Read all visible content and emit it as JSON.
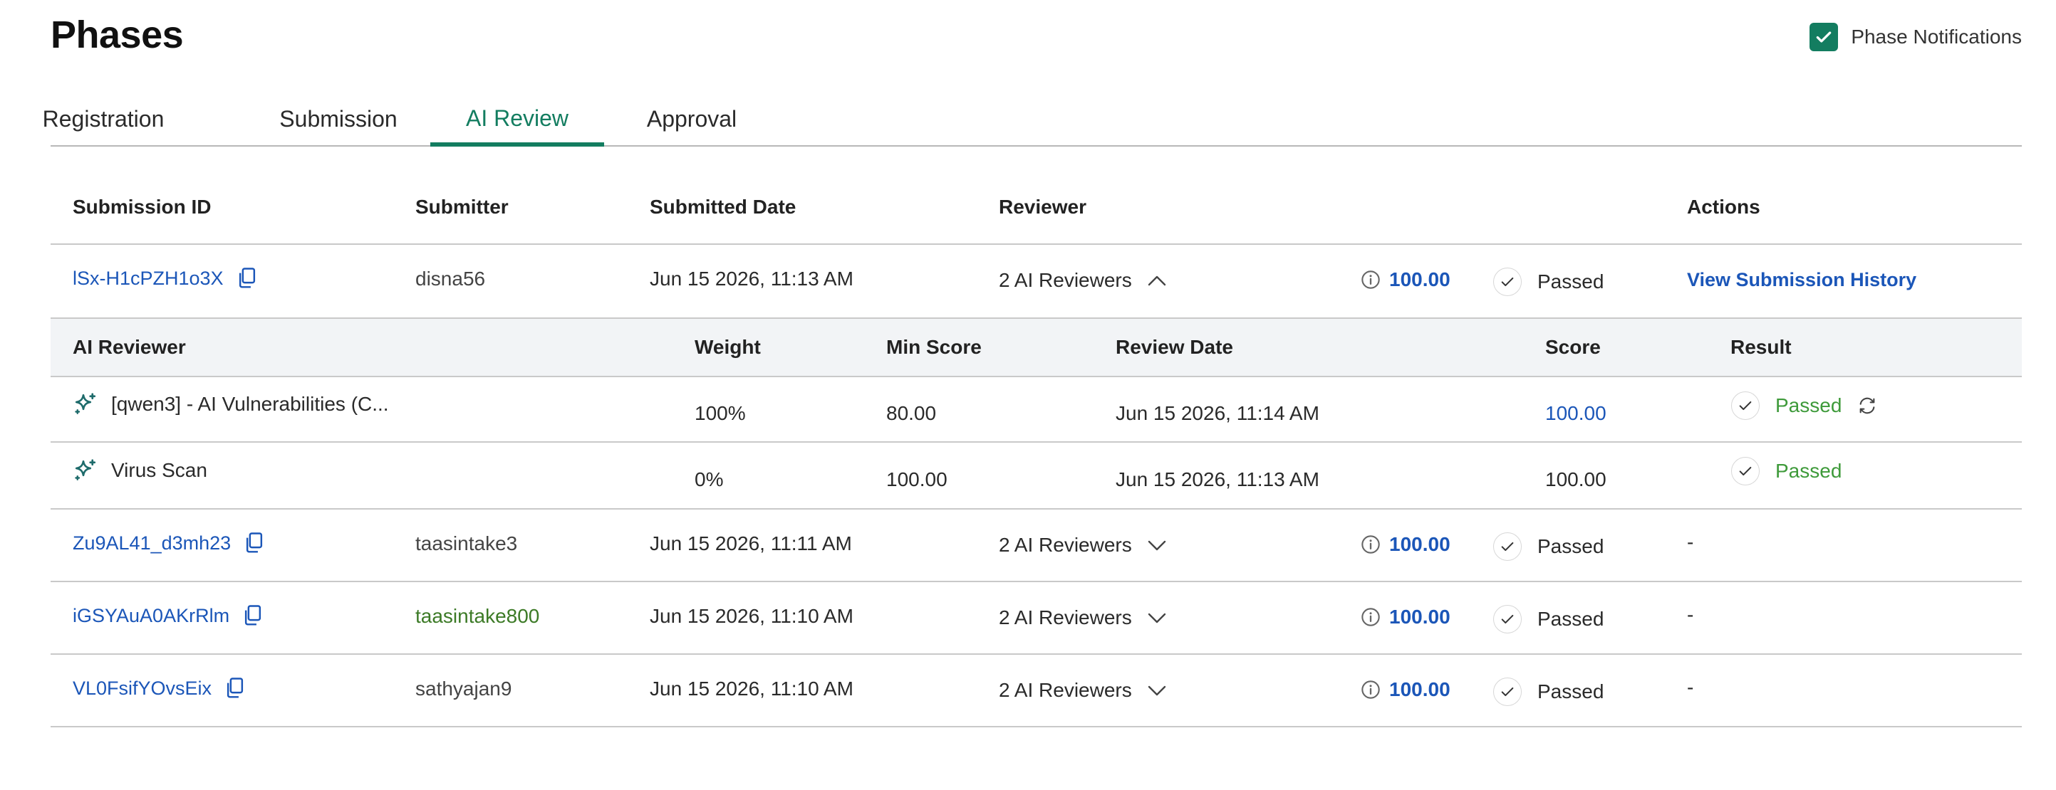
{
  "page": {
    "title": "Phases",
    "notifications_label": "Phase Notifications"
  },
  "tabs": [
    {
      "label": "Registration"
    },
    {
      "label": "Submission"
    },
    {
      "label": "AI Review"
    },
    {
      "label": "Approval"
    }
  ],
  "active_tab": "AI Review",
  "table": {
    "headers": {
      "submission_id": "Submission ID",
      "submitter": "Submitter",
      "submitted_date": "Submitted Date",
      "reviewer": "Reviewer",
      "actions": "Actions"
    },
    "rows": [
      {
        "id": "lSx-H1cPZH1o3X",
        "submitter": "disna56",
        "date": "Jun 15 2026, 11:13 AM",
        "reviewer": "2 AI Reviewers",
        "expanded": true,
        "score": "100.00",
        "status": "Passed",
        "action": "View Submission History"
      },
      {
        "id": "Zu9AL41_d3mh23",
        "submitter": "taasintake3",
        "date": "Jun 15 2026, 11:11 AM",
        "reviewer": "2 AI Reviewers",
        "expanded": false,
        "score": "100.00",
        "status": "Passed",
        "action": "-"
      },
      {
        "id": "iGSYAuA0AKrRlm",
        "submitter": "taasintake800",
        "date": "Jun 15 2026, 11:10 AM",
        "reviewer": "2 AI Reviewers",
        "expanded": false,
        "score": "100.00",
        "status": "Passed",
        "action": "-"
      },
      {
        "id": "VL0FsifYOvsEix",
        "submitter": "sathyajan9",
        "date": "Jun 15 2026, 11:10 AM",
        "reviewer": "2 AI Reviewers",
        "expanded": false,
        "score": "100.00",
        "status": "Passed",
        "action": "-"
      }
    ]
  },
  "ai_subtable": {
    "headers": {
      "ai_reviewer": "AI Reviewer",
      "weight": "Weight",
      "min_score": "Min Score",
      "review_date": "Review Date",
      "score": "Score",
      "result": "Result"
    },
    "rows": [
      {
        "name": "[qwen3] - AI Vulnerabilities (C...",
        "weight": "100%",
        "min_score": "80.00",
        "review_date": "Jun 15 2026, 11:14 AM",
        "score": "100.00",
        "result": "Passed"
      },
      {
        "name": "Virus Scan",
        "weight": "0%",
        "min_score": "100.00",
        "review_date": "Jun 15 2026, 11:13 AM",
        "score": "100.00",
        "result": "Passed"
      }
    ]
  },
  "colors": {
    "accent": "#137d60",
    "link": "#1b56b8",
    "passed_green": "#3e9a3a",
    "submitter_green": "#3c7a26"
  }
}
